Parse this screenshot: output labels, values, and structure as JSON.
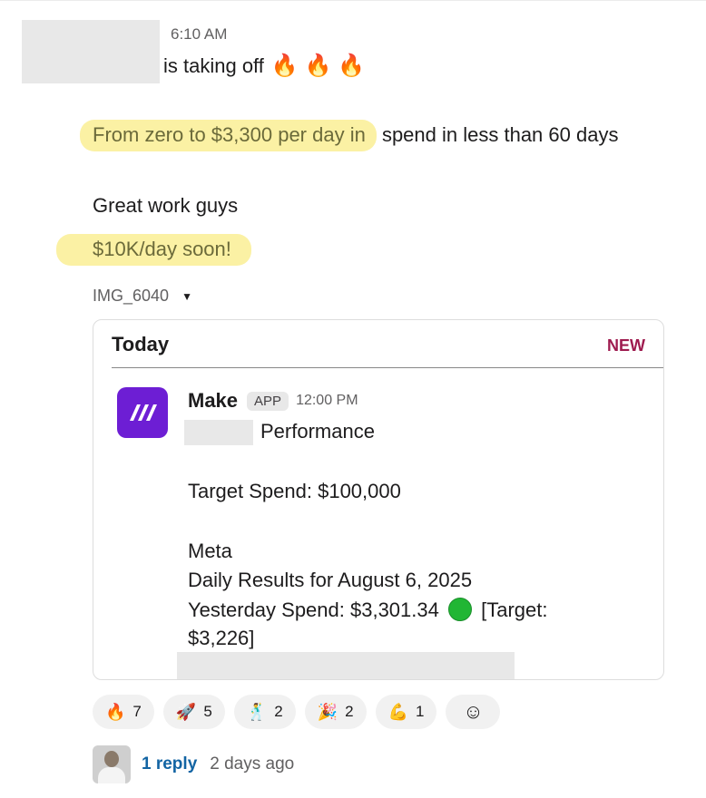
{
  "message": {
    "timestamp": "6:10 AM",
    "line1": "is taking off",
    "line1_emojis": "🔥 🔥 🔥",
    "line2_highlight": "From zero to $3,300 per day in",
    "line2_rest": " spend in less than 60 days",
    "line3": "Great work guys",
    "line4_highlight": "$10K/day soon!",
    "attachment_name": "IMG_6040",
    "attachment_caret": "▼"
  },
  "card": {
    "header": "Today",
    "new_label": "NEW",
    "avatar_glyph": "/\\/\\",
    "sender": "Make",
    "badge": "APP",
    "time": "12:00 PM",
    "performance": "Performance",
    "target_spend": "Target Spend: $100,000",
    "platform": "Meta",
    "daily_results": "Daily Results for August 6, 2025",
    "yesterday_spend": "Yesterday Spend: $3,301.34",
    "target_suffix": "[Target:",
    "target_value": "$3,226]"
  },
  "reactions": [
    {
      "emoji": "🔥",
      "count": "7",
      "icon": "fire-icon"
    },
    {
      "emoji": "🚀",
      "count": "5",
      "icon": "rocket-icon"
    },
    {
      "emoji": "🕺",
      "count": "2",
      "icon": "dancer-icon"
    },
    {
      "emoji": "🎉",
      "count": "2",
      "icon": "party-popper-icon"
    },
    {
      "emoji": "💪",
      "count": "1",
      "icon": "flexed-biceps-icon"
    }
  ],
  "add_reaction_icon": "☺",
  "thread": {
    "reply_count": "1 reply",
    "last_reply": "2 days ago"
  },
  "colors": {
    "highlight": "#fbf1a4",
    "new_label": "#9e1b4f",
    "make_brand": "#6d1ed4",
    "link": "#1264a3",
    "status_green": "#21b634"
  }
}
